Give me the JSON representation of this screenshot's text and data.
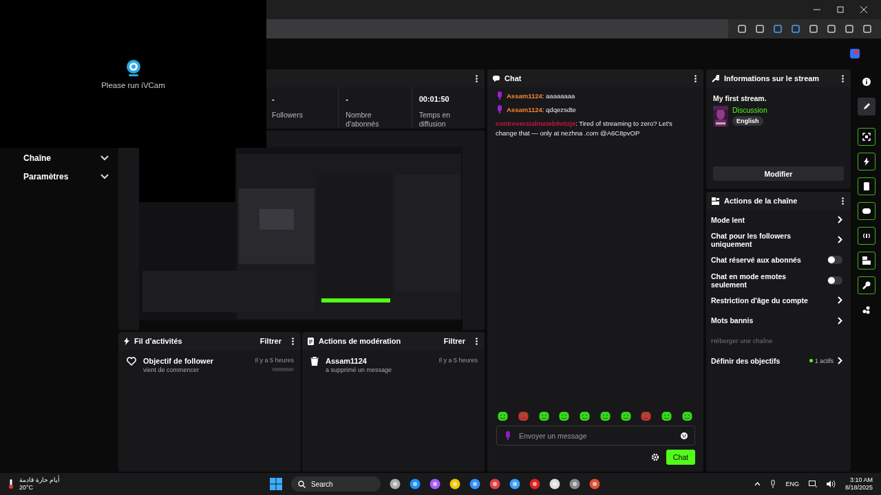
{
  "ivcam": {
    "message": "Please run iVCam"
  },
  "sidebar": {
    "items": [
      {
        "label": "Chaîne",
        "expanded": false
      },
      {
        "label": "Paramètres",
        "expanded": false
      }
    ]
  },
  "stats": [
    {
      "value": "-",
      "label": "Followers"
    },
    {
      "value": "-",
      "label": "Nombre d'abonnés"
    },
    {
      "value": "00:01:50",
      "label": "Temps en diffusion"
    }
  ],
  "activity": {
    "title": "Fil d’activités",
    "filter": "Filtrer",
    "items": [
      {
        "title": "Objectif de follower",
        "subtitle": "vient de commencer",
        "time": "Il y a 5 heures",
        "level": 0
      }
    ]
  },
  "moderation": {
    "title": "Actions de modération",
    "filter": "Filtrer",
    "items": [
      {
        "user": "Assam1124",
        "action": "a supprimé un message",
        "time": "Il y a 5 heures"
      }
    ]
  },
  "chat": {
    "title": "Chat",
    "placeholder": "Envoyer un message",
    "send": "Chat",
    "messages": [
      {
        "user": "Assam1124",
        "text": ": aaaaaaaa",
        "color": "#f5892a",
        "badge": true
      },
      {
        "user": "Assam1124",
        "text": ": qdqezsdte",
        "color": "#f5892a",
        "badge": true
      },
      {
        "user": "controversialmateb9v0zje",
        "text": ": Tired of streaming to zero? Let's change that — only at nezhna .com @A6C8pvOP",
        "color": "#c4163e",
        "badge": false
      }
    ]
  },
  "stream_info": {
    "title": "Informations sur le stream",
    "stream_title": "My first stream.",
    "category": "Discussion",
    "tag": "English",
    "edit": "Modifier"
  },
  "channel_actions": {
    "title": "Actions de la chaîne",
    "items": [
      {
        "kind": "link",
        "label": "Mode lent",
        "disabled": false
      },
      {
        "kind": "link",
        "label": "Chat pour les followers uniquement",
        "disabled": false
      },
      {
        "kind": "toggle",
        "label": "Chat réservé aux abonnés",
        "on": false,
        "disabled": false
      },
      {
        "kind": "toggle",
        "label": "Chat en mode emotes seulement",
        "on": false,
        "disabled": false
      },
      {
        "kind": "link",
        "label": "Restriction d'âge du compte",
        "disabled": false
      },
      {
        "kind": "link",
        "label": "Mots bannis",
        "disabled": false
      },
      {
        "kind": "link",
        "label": "Héberger une chaîne",
        "disabled": true
      },
      {
        "kind": "link",
        "label": "Définir des objectifs",
        "badge": "1 actifs",
        "disabled": false
      }
    ]
  },
  "rail": [
    {
      "kind": "plain",
      "selected": false
    },
    {
      "kind": "plain",
      "selected": true
    },
    {
      "kind": "outlined",
      "selected": false
    },
    {
      "kind": "outlined",
      "selected": false
    },
    {
      "kind": "outlined",
      "selected": false
    },
    {
      "kind": "outlined",
      "selected": false
    },
    {
      "kind": "outlined",
      "selected": false
    },
    {
      "kind": "outlined",
      "selected": false
    },
    {
      "kind": "outlined",
      "selected": false
    },
    {
      "kind": "plain",
      "selected": false
    }
  ],
  "taskbar": {
    "weather": "أيام حارة قادمة",
    "temperature": "20°C",
    "search": "Search",
    "language": "ENG",
    "time": "3:10 AM",
    "date": "8/18/2025"
  }
}
